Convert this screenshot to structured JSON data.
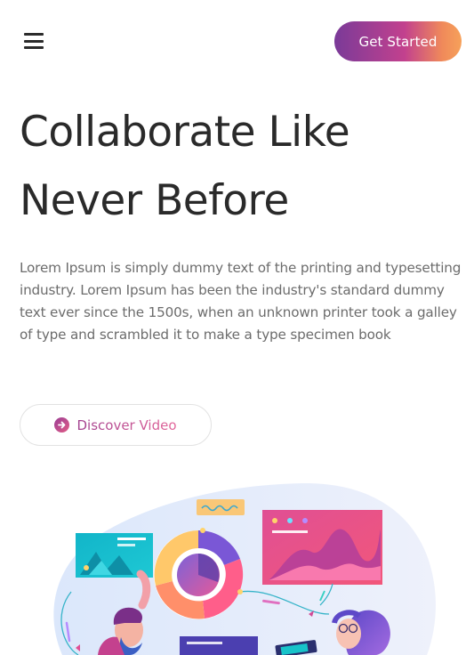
{
  "header": {
    "menu_icon": "hamburger-menu-icon",
    "cta_label": "Get Started"
  },
  "hero": {
    "title": "Collaborate Like Never Before",
    "description": "Lorem Ipsum is simply dummy text of the printing and typesetting industry. Lorem Ipsum has been the industry's standard dummy text ever since the 1500s, when an unknown printer took a galley of type and scrambled it to make a type specimen book",
    "video_button_label": "Discover Video",
    "video_icon": "play-arrow-icon"
  },
  "illustration": {
    "name": "team-collaboration-illustration"
  },
  "colors": {
    "gradient_start": "#7a3a98",
    "gradient_mid": "#c2418e",
    "gradient_end": "#f6a15a",
    "heading": "#2a2a2a",
    "body_text": "#6c6c6c"
  }
}
